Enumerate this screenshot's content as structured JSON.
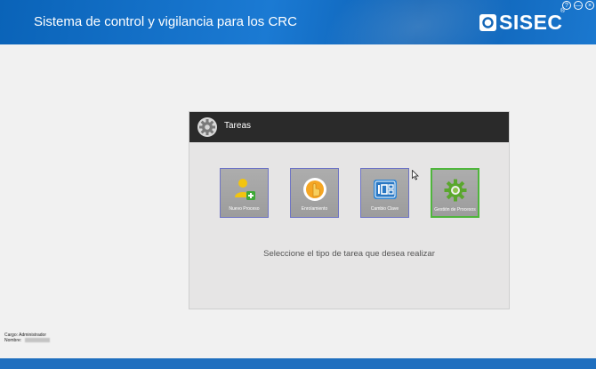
{
  "header": {
    "app_title": "Sistema de control y vigilancia para los CRC",
    "logo_text": "SISEC",
    "logo_reg": "®",
    "window_buttons": [
      "?",
      "—",
      "×"
    ],
    "colors": {
      "primary": "#1470c6",
      "footer": "#1f6fbf"
    }
  },
  "panel": {
    "title": "Tareas",
    "instruction": "Seleccione el tipo de tarea que desea realizar",
    "tiles": [
      {
        "label": "Nuevo Proceso",
        "icon": "user-add-icon",
        "selected": false
      },
      {
        "label": "Enrolamiento",
        "icon": "fingerprint-touch-icon",
        "selected": false
      },
      {
        "label": "Cambio Clave",
        "icon": "keypad-icon",
        "selected": false
      },
      {
        "label": "Gestión de Procesos",
        "icon": "gear-icon",
        "selected": true
      }
    ]
  },
  "footer": {
    "cargo_label": "Cargo:",
    "cargo_value": "Administrador",
    "nombre_label": "Nombre:"
  }
}
